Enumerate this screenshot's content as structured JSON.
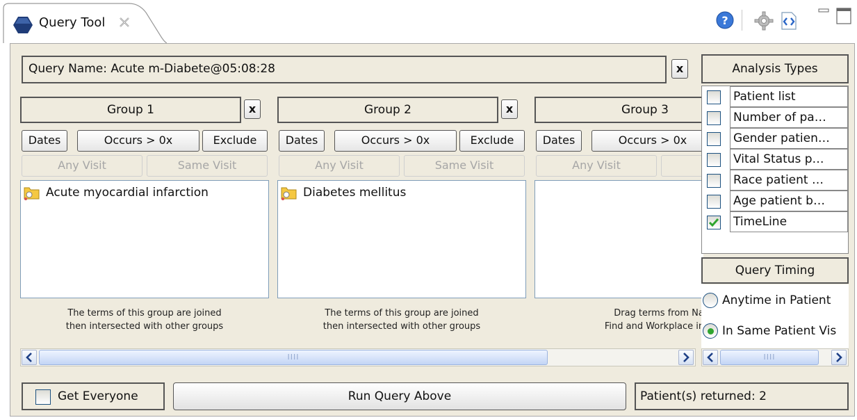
{
  "tab": {
    "title": "Query Tool"
  },
  "colors": {
    "panel_bg": "#efebde",
    "check_green": "#2fa52f",
    "folder_yellow": "#f5c842"
  },
  "toolbar_icons": [
    "help-icon",
    "gear-icon",
    "code-icon",
    "minimize-icon",
    "maximize-icon"
  ],
  "query": {
    "name": "Query Name: Acute m-Diabete@05:08:28",
    "clear_label": "x"
  },
  "groups": [
    {
      "title": "Group 1",
      "close_label": "x",
      "dates_label": "Dates",
      "occurs_label": "Occurs > 0x",
      "exclude_label": "Exclude",
      "any_visit_label": "Any Visit",
      "same_visit_label": "Same Visit",
      "items": [
        "Acute myocardial infarction"
      ],
      "note_line1": "The terms of this group are joined",
      "note_line2": "then intersected with other groups"
    },
    {
      "title": "Group 2",
      "close_label": "x",
      "dates_label": "Dates",
      "occurs_label": "Occurs > 0x",
      "exclude_label": "Exclude",
      "any_visit_label": "Any Visit",
      "same_visit_label": "Same Visit",
      "items": [
        "Diabetes mellitus"
      ],
      "note_line1": "The terms of this group are joined",
      "note_line2": "then intersected with other groups"
    },
    {
      "title": "Group 3",
      "dates_label": "Dates",
      "occurs_label": "Occurs > 0x",
      "any_visit_label": "Any Visit",
      "same_visit_label": "S",
      "items": [],
      "note_line1": "Drag terms from Na",
      "note_line2": "Find and Workplace into"
    }
  ],
  "analysis": {
    "title": "Analysis Types",
    "types": [
      {
        "label": "Patient list",
        "checked": false
      },
      {
        "label": "Number of pa…",
        "checked": false
      },
      {
        "label": "Gender patien…",
        "checked": false
      },
      {
        "label": "Vital Status p…",
        "checked": false
      },
      {
        "label": "Race patient …",
        "checked": false
      },
      {
        "label": "Age patient b…",
        "checked": false
      },
      {
        "label": "TimeLine",
        "checked": true
      }
    ]
  },
  "timing": {
    "title": "Query Timing",
    "options": [
      {
        "label": "Anytime in Patient",
        "selected": false
      },
      {
        "label": "In Same Patient Vis",
        "selected": true
      }
    ]
  },
  "bottom": {
    "get_everyone_label": "Get Everyone",
    "get_everyone_checked": false,
    "run_label": "Run Query Above",
    "returned_label": "Patient(s) returned: 2"
  },
  "scroll_grip": "IIII"
}
